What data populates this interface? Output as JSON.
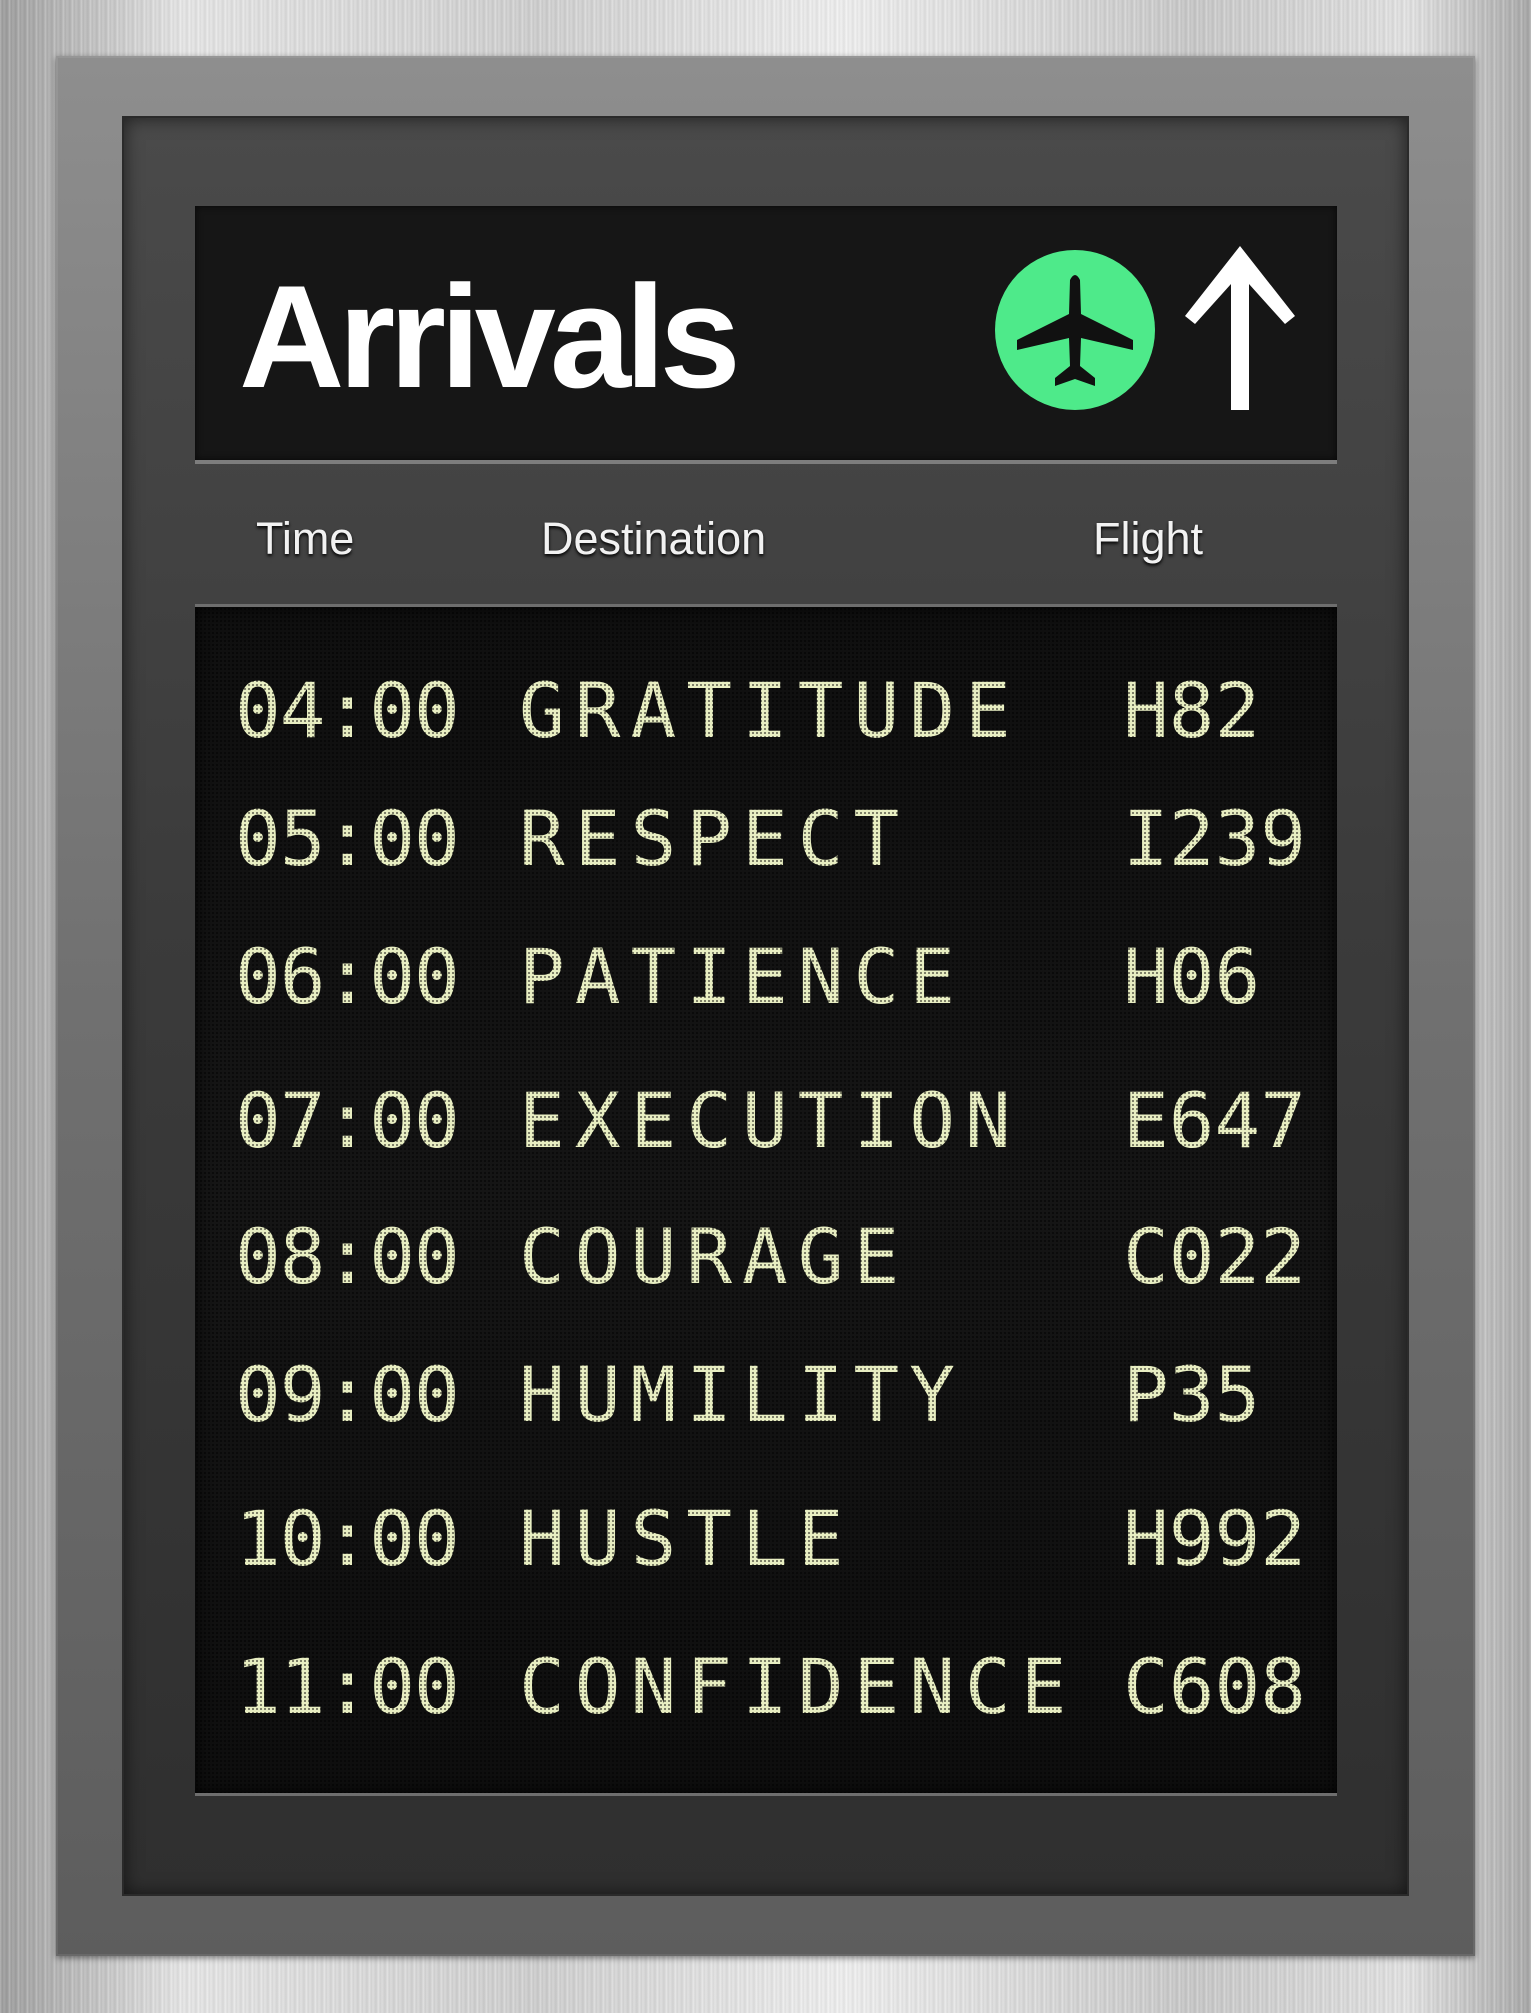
{
  "header": {
    "title": "Arrivals",
    "badge_icon": "airplane-icon",
    "arrow_icon": "arrow-up-icon",
    "badge_color": "#4eea8a"
  },
  "columns": {
    "time": "Time",
    "destination": "Destination",
    "flight": "Flight"
  },
  "rows": [
    {
      "time": "04:00",
      "destination": "GRATITUDE",
      "flight": "H82"
    },
    {
      "time": "05:00",
      "destination": "RESPECT",
      "flight": "I239"
    },
    {
      "time": "06:00",
      "destination": "PATIENCE",
      "flight": "H06"
    },
    {
      "time": "07:00",
      "destination": "EXECUTION",
      "flight": "E647"
    },
    {
      "time": "08:00",
      "destination": "COURAGE",
      "flight": "C022"
    },
    {
      "time": "09:00",
      "destination": "HUMILITY",
      "flight": "P35"
    },
    {
      "time": "10:00",
      "destination": "HUSTLE",
      "flight": "H992"
    },
    {
      "time": "11:00",
      "destination": "CONFIDENCE",
      "flight": "C608"
    }
  ],
  "display_text_color": "#e8eec2"
}
